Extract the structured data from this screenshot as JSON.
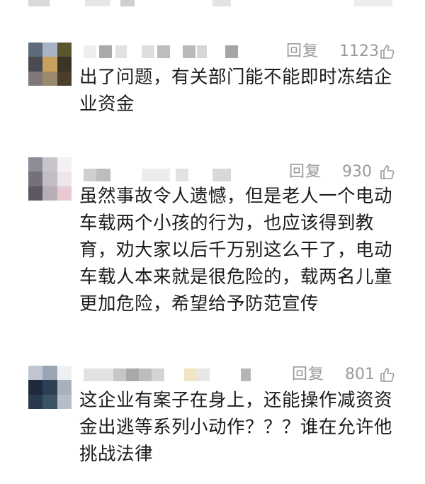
{
  "comments": [
    {
      "reply_label": "回复",
      "like_count": "1123",
      "text": "出了问题，有关部门能不能即时冻结企\n业资金"
    },
    {
      "reply_label": "回复",
      "like_count": "930",
      "text": "虽然事故令人遗憾，但是老人一个电动\n车载两个小孩的行为，也应该得到教\n育，劝大家以后千万别这么干了，电动\n车载人本来就是很危险的，载两名儿童\n更加危险，希望给予防范宣传"
    },
    {
      "reply_label": "回复",
      "like_count": "801",
      "text": "这企业有案子在身上，还能操作减资资\n金出逃等系列小动作？？？谁在允许他\n挑战法律"
    }
  ],
  "icons": {
    "like": "thumbs-up-icon",
    "avatar": "pixelated-avatar",
    "username": "pixelated-username"
  },
  "colors": {
    "meta_text": "#9a9a9a",
    "body_text": "#1b1b1b",
    "background": "#ffffff"
  }
}
